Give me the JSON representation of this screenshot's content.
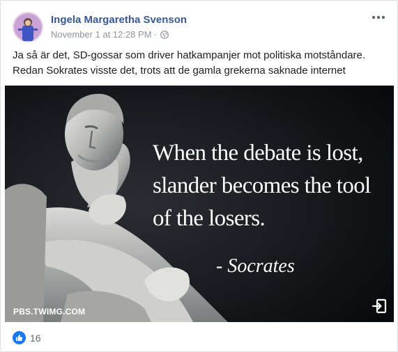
{
  "post": {
    "author": "Ingela Margaretha Svenson",
    "timestamp": "November 1 at 12:28 PM",
    "separator": "·",
    "privacy_icon": "globe-icon",
    "more_icon": "more-options-icon",
    "text_lines": [
      "Ja så är det, SD-gossar som driver hatkampanjer mot politiska motståndare.",
      "Redan Sokrates visste det, trots att de gamla grekerna saknade internet"
    ]
  },
  "image": {
    "quote_lines": [
      "When the debate is lost,",
      "slander becomes the tool",
      "of the losers."
    ],
    "attribution": "- Socrates",
    "source": "PBS.TWIMG.COM",
    "open_icon": "external-link-icon"
  },
  "reactions": {
    "icon": "like-icon",
    "count": "16"
  },
  "colors": {
    "link": "#385898",
    "like_blue": "#1877f2",
    "meta_gray": "#90949c"
  }
}
